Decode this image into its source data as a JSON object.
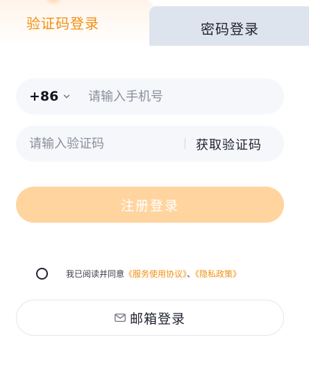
{
  "tabs": {
    "active_label": "验证码登录",
    "inactive_label": "密码登录"
  },
  "phone": {
    "country_code": "+86",
    "placeholder": "请输入手机号"
  },
  "code": {
    "placeholder": "请输入验证码",
    "get_code_label": "获取验证码"
  },
  "submit_label": "注册登录",
  "agreement": {
    "prefix": "我已阅读并同意",
    "service_link": "《服务使用协议》",
    "separator": "、",
    "privacy_link": "《隐私政策》"
  },
  "email_login_label": "邮箱登录",
  "icons": {
    "chevron": "chevron-down-icon",
    "mail": "mail-icon"
  },
  "colors": {
    "accent": "#f38f12",
    "submit_bg": "#ffd49f",
    "inactive_tab_bg": "#dde4ee",
    "field_bg": "#f5f7fb"
  }
}
